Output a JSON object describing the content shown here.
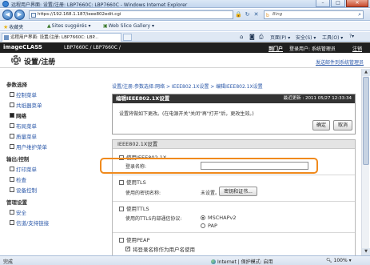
{
  "window": {
    "title": "远程用户界面: 设置/注册: LBP7660C: LBP7660C - Windows Internet Explorer",
    "buttons": [
      "–",
      "□",
      "✕"
    ]
  },
  "browser": {
    "url": "https://192.168.1.187/ieee802edit.cgi",
    "search_placeholder": "Bing",
    "favorites_label": "收藏夹",
    "fav_links": [
      "Sites suggérés ▾",
      "Web Slice Gallery ▾"
    ],
    "tab_title": "远程用户界面: 设置/注册: LBP7660C: LBP...",
    "commands": [
      "页面(P) ▾",
      "安全(S) ▾",
      "工具(O) ▾",
      "?▾"
    ]
  },
  "header": {
    "brand": "imageCLASS",
    "model": "LBP7660C / LBP7660C /",
    "config_link": "到门户",
    "login_user": "登录用户: 系统管理员",
    "logout": "注销"
  },
  "subheader": {
    "title": "设置/注册",
    "mail_admin": "发送邮件到系统管理员"
  },
  "sidebar": {
    "sections": [
      {
        "title": "参数选择",
        "items": [
          "控制菜单",
          "共纸器菜单",
          "网络",
          "布局菜单",
          "质量菜单",
          "用户维护菜单"
        ]
      },
      {
        "title": "输出/控制",
        "items": [
          "打印菜单",
          "检查",
          "设备控制"
        ]
      },
      {
        "title": "管理设置",
        "items": [
          "安全",
          "信道/支持链接"
        ]
      }
    ],
    "active_item": "网络"
  },
  "breadcrumb": {
    "path": "设置/注册:参数选择:网络 > IEEE802.1X设置 > 编辑IEEE802.1X设置"
  },
  "edit_panel": {
    "title": "编辑IEEE802.1X设置",
    "last_updated": "最近更新 : 2011 05/27 12:33:34",
    "message": "设置将做如下更改。(在电源开关\"关闭\"再\"打开\"后，更改生效。)",
    "ok_label": "确定",
    "cancel_label": "取消"
  },
  "section": {
    "title": "IEEE802.1X设置",
    "use_ieee_label": "使用IEEE802.1X",
    "use_ieee_checked": false,
    "login_name_label": "登录名称:",
    "login_name_value": "",
    "use_tls_label": "使用TLS",
    "use_tls_checked": false,
    "key_cert_label": "使用的密钥名称:",
    "key_cert_value": "未设置。",
    "key_cert_button": "密钥和证书...",
    "use_ttls_label": "使用TTLS",
    "use_ttls_checked": false,
    "ttls_protocol_label": "使用的TTLS内部通信协议:",
    "ttls_options": [
      "MSCHAPv2",
      "PAP"
    ],
    "ttls_selected": "MSCHAPv2",
    "use_peap_label": "使用PEAP",
    "use_peap_checked": false,
    "login_as_user_label": "将登录名称作为用户名使用",
    "login_as_user_checked": true
  },
  "statusbar": {
    "left": "完成",
    "zone": "Internet | 保护模式: 启用",
    "zoom": "100%"
  }
}
